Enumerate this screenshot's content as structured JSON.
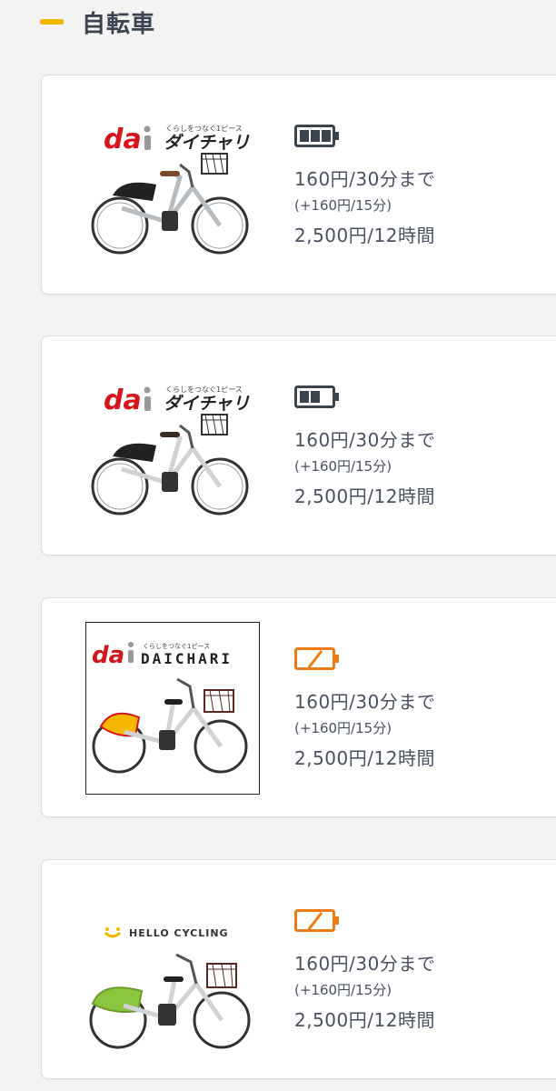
{
  "section": {
    "title": "自転車"
  },
  "colors": {
    "accent": "#f5b800",
    "battery_full": "#3c4450",
    "battery_low": "#f07a14",
    "logo_red": "#d8141b"
  },
  "cards": [
    {
      "brand_logo": "ダイチャリ",
      "logo_tagline": "くらしをつなぐ1ピース",
      "logo_mark": "da",
      "battery_icon": "battery-full-icon",
      "battery_level": 1.0,
      "price_main": "160円/30分まで",
      "price_extra": "(+160円/15分)",
      "price_max": "2,500円/12時間"
    },
    {
      "brand_logo": "ダイチャリ",
      "logo_tagline": "くらしをつなぐ1ピース",
      "logo_mark": "da",
      "battery_icon": "battery-medium-icon",
      "battery_level": 0.67,
      "price_main": "160円/30分まで",
      "price_extra": "(+160円/15分)",
      "price_max": "2,500円/12時間"
    },
    {
      "brand_logo": "DAICHARI",
      "logo_tagline": "くらしをつなぐ1ピース",
      "logo_mark": "da",
      "battery_icon": "battery-low-icon",
      "battery_level": 0.0,
      "price_main": "160円/30分まで",
      "price_extra": "(+160円/15分)",
      "price_max": "2,500円/12時間"
    },
    {
      "brand_logo": "HELLO CYCLING",
      "battery_icon": "battery-low-icon",
      "battery_level": 0.0,
      "price_main": "160円/30分まで",
      "price_extra": "(+160円/15分)",
      "price_max": "2,500円/12時間"
    }
  ]
}
